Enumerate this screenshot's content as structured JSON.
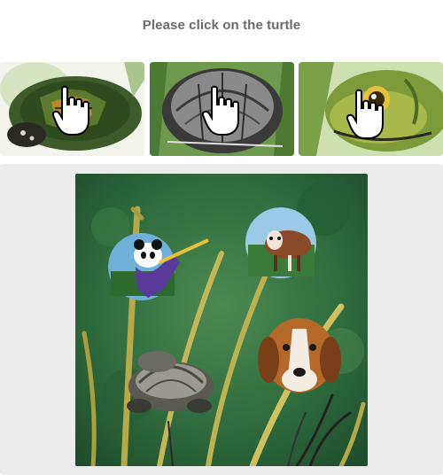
{
  "prompt": {
    "text": "Please click on the turtle"
  },
  "examples": [
    {
      "subject": "turtle-shell-top"
    },
    {
      "subject": "turtle-shell-grey"
    },
    {
      "subject": "turtle-head"
    }
  ],
  "colors": {
    "prompt_text": "#6a6a6a",
    "panel_background": "#ececec",
    "canvas_green": "#2f6b3c"
  }
}
